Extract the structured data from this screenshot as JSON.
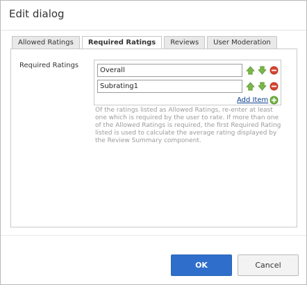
{
  "dialog": {
    "title": "Edit dialog"
  },
  "tabs": [
    {
      "label": "Allowed Ratings",
      "active": false
    },
    {
      "label": "Required Ratings",
      "active": true
    },
    {
      "label": "Reviews",
      "active": false
    },
    {
      "label": "User Moderation",
      "active": false
    }
  ],
  "form": {
    "field_label": "Required Ratings",
    "items": [
      {
        "value": "Overall"
      },
      {
        "value": "Subrating1"
      }
    ],
    "add_item_label": "Add Item",
    "help_text": "Of the ratings listed as Allowed Ratings, re-enter at least one which is required by the user to rate. If more than one of the Allowed Ratings is required, the first Required Rating listed is used to calculate the average rating displayed by the Review Summary component."
  },
  "footer": {
    "ok_label": "OK",
    "cancel_label": "Cancel"
  },
  "colors": {
    "move_arrow": "#7ab648",
    "remove": "#d9432f",
    "add": "#6fb13f",
    "link": "#0b3f8f",
    "primary_button": "#2f6fcb"
  },
  "icons": {
    "move_up": "arrow-up-icon",
    "move_down": "arrow-down-icon",
    "remove": "remove-icon",
    "add": "add-icon"
  }
}
